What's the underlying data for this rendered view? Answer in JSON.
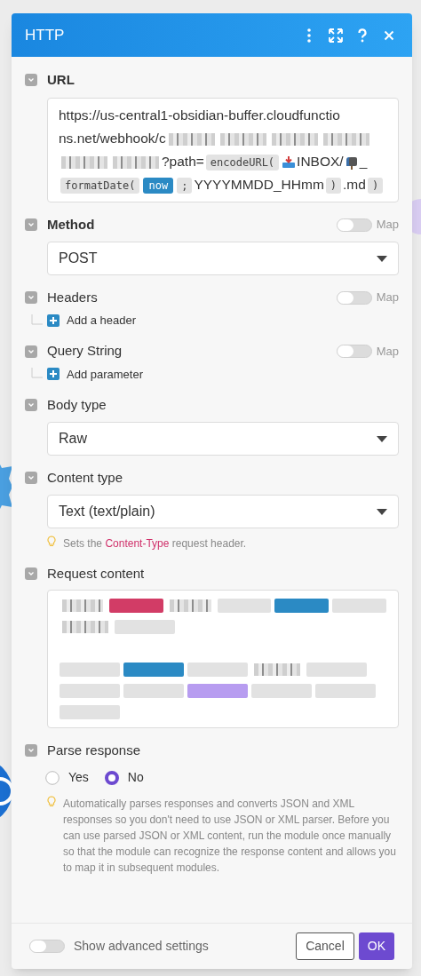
{
  "window": {
    "title": "HTTP",
    "actions": [
      {
        "kind": "more"
      },
      {
        "kind": "expand"
      },
      {
        "kind": "help"
      },
      {
        "kind": "close"
      }
    ]
  },
  "fields": [
    {
      "kind": "url",
      "label": "URL",
      "bold": true,
      "expanded": true,
      "segments": [
        {
          "kind": "text",
          "text": "https://us-central1-obsidian-buffer.cloudfunctio"
        },
        {
          "kind": "text",
          "text": "ns.net/webhook/c"
        },
        {
          "kind": "redacted"
        },
        {
          "kind": "redacted"
        },
        {
          "kind": "redacted"
        },
        {
          "kind": "redacted"
        },
        {
          "kind": "redacted"
        },
        {
          "kind": "redacted"
        },
        {
          "kind": "text",
          "text": "?path="
        },
        {
          "kind": "function",
          "text": "encodeURL("
        },
        {
          "kind": "tray"
        },
        {
          "kind": "text",
          "text": "INBOX/"
        },
        {
          "kind": "mailbox"
        },
        {
          "kind": "text",
          "text": "_"
        },
        {
          "kind": "function",
          "text": "formatDate("
        },
        {
          "kind": "variable",
          "text": "now"
        },
        {
          "kind": "function",
          "text": ";"
        },
        {
          "kind": "text",
          "text": "YYYYMMDD_HHmm"
        },
        {
          "kind": "function",
          "text": ")"
        },
        {
          "kind": "text",
          "text": ".md"
        },
        {
          "kind": "function",
          "text": ")"
        }
      ]
    },
    {
      "kind": "select",
      "label": "Method",
      "bold": true,
      "expanded": true,
      "map": {
        "on": false,
        "label": "Map"
      },
      "value": "POST"
    },
    {
      "kind": "list",
      "label": "Headers",
      "bold": false,
      "expanded": true,
      "map": {
        "on": false,
        "label": "Map"
      },
      "add_label": "Add a header"
    },
    {
      "kind": "list",
      "label": "Query String",
      "bold": false,
      "expanded": true,
      "map": {
        "on": false,
        "label": "Map"
      },
      "add_label": "Add parameter"
    },
    {
      "kind": "select",
      "label": "Body type",
      "bold": false,
      "expanded": true,
      "value": "Raw"
    },
    {
      "kind": "select",
      "label": "Content type",
      "bold": false,
      "expanded": true,
      "value": "Text (text/plain)",
      "hint": "Sets the **Content-Type** request header."
    },
    {
      "kind": "content",
      "label": "Request content",
      "bold": false,
      "expanded": true,
      "lines": [
        {
          "kind": "tags",
          "segments": [
            {
              "kind": "redacted"
            },
            {
              "kind": "pill",
              "color": "#d23c66"
            },
            {
              "kind": "redacted"
            },
            {
              "kind": "pill",
              "color": "#e2e2e2"
            },
            {
              "kind": "pill",
              "color": "#2b8ac4"
            },
            {
              "kind": "pill",
              "color": "#e2e2e2"
            }
          ]
        },
        {
          "kind": "tags",
          "segments": [
            {
              "kind": "redacted"
            },
            {
              "kind": "pill",
              "color": "#e2e2e2"
            }
          ]
        },
        {
          "kind": "blank"
        },
        {
          "kind": "tags",
          "segments": [
            {
              "kind": "pill",
              "color": "#e2e2e2"
            },
            {
              "kind": "pill",
              "color": "#2b8ac4"
            },
            {
              "kind": "pill",
              "color": "#e2e2e2"
            },
            {
              "kind": "redacted"
            },
            {
              "kind": "pill",
              "color": "#e2e2e2"
            }
          ]
        },
        {
          "kind": "tags",
          "segments": [
            {
              "kind": "pill",
              "color": "#e2e2e2"
            },
            {
              "kind": "pill",
              "color": "#e2e2e2"
            },
            {
              "kind": "pill",
              "color": "#b79cf0"
            },
            {
              "kind": "pill",
              "color": "#e2e2e2"
            },
            {
              "kind": "pill",
              "color": "#e2e2e2"
            }
          ]
        },
        {
          "kind": "tags",
          "segments": [
            {
              "kind": "pill",
              "color": "#e2e2e2"
            }
          ]
        }
      ]
    },
    {
      "kind": "radio",
      "label": "Parse response",
      "bold": false,
      "expanded": true,
      "options": [
        {
          "label": "Yes",
          "selected": false
        },
        {
          "label": "No",
          "selected": true
        }
      ],
      "hint": "Automatically parses responses and converts JSON and XML responses so you don't need to use JSON or XML parser. Before you can use parsed JSON or XML content, run the module once manually so that the module can recognize the response content and allows you to map it in subsequent modules."
    }
  ],
  "footer": {
    "advanced": {
      "on": false,
      "label": "Show advanced settings"
    },
    "buttons": [
      {
        "kind": "secondary",
        "label": "Cancel"
      },
      {
        "kind": "primary",
        "label": "OK"
      }
    ]
  }
}
